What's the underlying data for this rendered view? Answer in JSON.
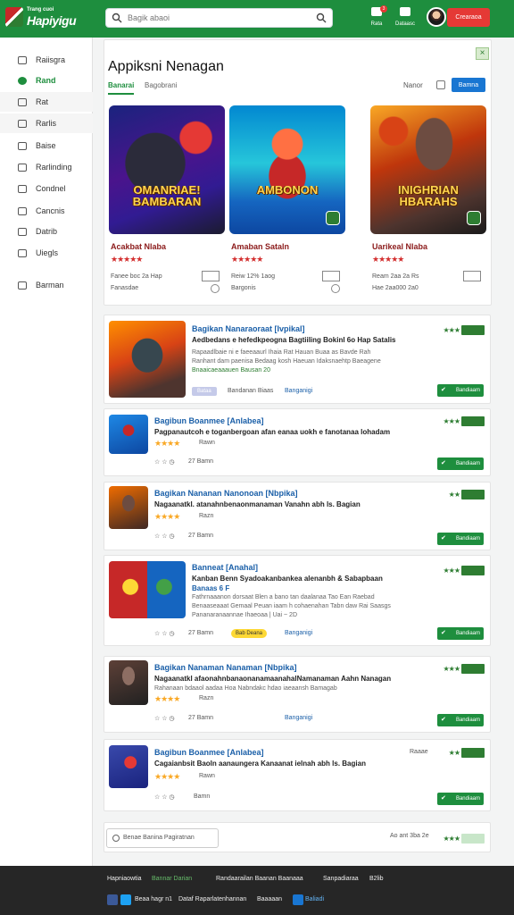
{
  "topbar": {
    "logo_small": "Trang cuoi",
    "logo_big": "Hapiyigu",
    "search_placeholder": "Bagik abaoi",
    "icon1_label": "Rata",
    "icon2_label": "Dataasc",
    "notif_count": "3",
    "button_label": "Crearaoa",
    "brand_color": "#1e8e3e"
  },
  "sidebar": {
    "items": [
      {
        "label": "Raiisgra",
        "icon": "home-icon"
      },
      {
        "label": "Rand",
        "icon": "circle-icon"
      },
      {
        "label": "Rat",
        "icon": "box-icon"
      },
      {
        "label": "Rarlis",
        "icon": "list-icon"
      },
      {
        "label": "Baise",
        "icon": "gear-icon"
      },
      {
        "label": "Rarlinding",
        "icon": "grid-icon"
      },
      {
        "label": "Condnel",
        "icon": "card-icon"
      },
      {
        "label": "Cancnis",
        "icon": "calendar-icon"
      },
      {
        "label": "Datrib",
        "icon": "tag-icon"
      },
      {
        "label": "Uiegls",
        "icon": "doc-icon"
      },
      {
        "label": "Barman",
        "icon": "settings-icon"
      }
    ]
  },
  "hero": {
    "title": "Appiksni Nenagan",
    "tab_active": "Banarai",
    "tab_2": "Bagobrani",
    "link": "Nanor",
    "button": "Bamna",
    "close": "×",
    "featured": [
      {
        "art_title": "OMANRIAE! BAMBARAN",
        "name": "Acakbat Nlaba",
        "stars": "★★★★★",
        "meta1": "Fanee boc 2a Hap",
        "meta2": "Fanasdae"
      },
      {
        "art_title": "AMBONON",
        "name": "Amaban Sataln",
        "stars": "★★★★★",
        "meta1": "Reiw 12% 1aog",
        "meta2": "Bargonis"
      },
      {
        "art_title": "INIGHRIAN HBARAHS",
        "name": "Uarikeal Nlaba",
        "stars": "★★★★★",
        "meta1": "Ream 2aa 2a Rs",
        "meta2": "Hae 2aa000 2a0"
      }
    ]
  },
  "list": [
    {
      "title": "Bagikan Nanaraoraat [Ivpikal]",
      "desc": "Aedbedans e hefedkpeogna Bagtiiling Bokinl 6o Hap Satalis",
      "fine1": "Rapaadlbaie ni e faeeaaurl Ihaia Rat Hauan Buaa as Bavde Rah",
      "fine2": "Ranhant dam paenisa Bedaag kosh Haeuan Idaksnaehtp Baeagene",
      "fine3": "Bnaaicaeaaauen Bausan 20",
      "chip": "Bataa",
      "meta": "Bandanan Biaas",
      "link": "Banganigi",
      "stars_r": "★★★",
      "download": "Bandiaam"
    },
    {
      "title": "Bagibun Boanmee [Anlabea]",
      "desc": "Pagpanautcoh e toganbergoan afan eanaa uokh e fanotanaa lohadam",
      "stars": "★★★★",
      "meta": "Rawn",
      "meta2": "27 Bamn",
      "stars_r": "★★★",
      "download": "Bandiaam"
    },
    {
      "title": "Bagikan Nananan Nanonoan [Nbpika]",
      "desc": "Nagaanatkl. atanahnbenaonmanaman Vanahn abh ls. Bagian",
      "stars": "★★★★",
      "meta": "Razn",
      "meta2": "27 Bamn",
      "stars_r": "★★",
      "download": "Bandiaam"
    },
    {
      "title": "Banneat [Anahal]",
      "desc": "Kanban Benn Syadoakanbankea alenanbh & Sabapbaan",
      "desc2": "Banaas 6 F",
      "fine1": "Fathrnaaanon dorsaat Blen a bano tan daalanaa Tao Ean Raebad",
      "fine2": "Benaaseaaat Gemaal Peuan iaam h cohaenahan Tabn daw Rai Saasgs",
      "fine3": "Pananaranaannae Ihaeoaa | Uai ~ 2D",
      "meta2": "27 Bamn",
      "ychip": "Bab Deana",
      "link": "Banganigi",
      "stars_r": "★★★",
      "download": "Bandiaam"
    },
    {
      "title": "Bagikan Nanaman Nanaman [Nbpika]",
      "desc": "Nagaanatkl afaonahnbanaonanamaanahalNamanaman Aahn Nanagan",
      "fine1": "Rahanaan bdaaol aadaa Hoa Nabndakc hdao iaeaansh Bamagab",
      "stars": "★★★★",
      "meta": "Razn",
      "meta2": "27 Bamn",
      "link": "Banganigi",
      "stars_r": "★★★",
      "download": "Bandiaam"
    },
    {
      "title": "Bagibun Boanmee [Anlabea]",
      "desc": "Cagaianbsit Baoln aanaungera Kanaanat ielnah abh ls. Bagian",
      "stars": "★★★★",
      "meta": "Rawn",
      "meta2": "Bamn",
      "rate_label": "Raaae",
      "stars_r": "★★",
      "download": "Bandiaam"
    }
  ],
  "pager": {
    "label": "Benae Banina Pagiratnan",
    "text": "Ao ant 3ba 2e"
  },
  "footer": {
    "row1": [
      "Hapniaowtia",
      "Bannar Darian",
      "Randaarailan Baanan Baanaaa",
      "Sanpadiaraa",
      "B2lib"
    ],
    "row2": [
      "Beaa hagr n1",
      "Dataf Raparlatenhannan",
      "Baaaaan",
      "Baliadi"
    ]
  }
}
